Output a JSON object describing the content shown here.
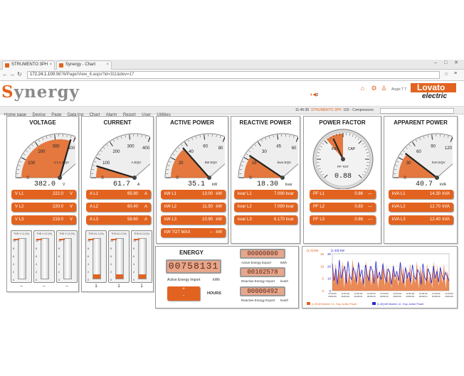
{
  "browser": {
    "tabs": [
      {
        "label": "STRUMENTO 3PH"
      },
      {
        "label": "Synergy - Chart"
      }
    ],
    "window_buttons": "– □ ✕",
    "url_host": "172.24.1.100",
    "url_path": ":9876/Page/View_6.aspx?id=311&dev=17"
  },
  "header": {
    "logo_s": "S",
    "logo_rest": "ynergy",
    "user": "Angie T T",
    "brand_top": "Lovato",
    "brand_bottom": "electric",
    "alarm_count": "2"
  },
  "menu": {
    "items": [
      "Home page",
      "Device",
      "Page",
      "Data log",
      "Chart",
      "Alarm",
      "Report",
      "User",
      "Utilities"
    ],
    "time": "11:46:38",
    "device": "STRUMENTO 3PH",
    "group": "102 - Compressors"
  },
  "voltage": {
    "title": "VOLTAGE",
    "gauge_value": "382.0",
    "gauge_unit": "V",
    "gauge_sub": "V L-L EQV",
    "ticks": [
      "0",
      "100",
      "200",
      "300",
      "400",
      "500"
    ],
    "rows": [
      {
        "label": "V L1",
        "value": "222.0",
        "unit": "V"
      },
      {
        "label": "V L2",
        "value": "220.0",
        "unit": "V"
      },
      {
        "label": "V L3",
        "value": "219.0",
        "unit": "V"
      }
    ],
    "bars": [
      {
        "title": "THD V L1 (%)",
        "ticks": [
          "10",
          "8",
          "6",
          "4",
          "2",
          "0"
        ],
        "value": "--",
        "level": 0
      },
      {
        "title": "THD V L2 (%)",
        "ticks": [
          "10",
          "8",
          "6",
          "4",
          "2",
          "0"
        ],
        "value": "--",
        "level": 0
      },
      {
        "title": "THD V L3 (%)",
        "ticks": [
          "10",
          "8",
          "6",
          "4",
          "2",
          "0"
        ],
        "value": "--",
        "level": 0
      }
    ]
  },
  "current": {
    "title": "CURRENT",
    "gauge_value": "61.7",
    "gauge_unit": "A",
    "gauge_sub": "A EQV",
    "ticks": [
      "0",
      "100",
      "200",
      "300",
      "400",
      "500"
    ],
    "rows": [
      {
        "label": "A L1",
        "value": "65.90",
        "unit": "A"
      },
      {
        "label": "A L2",
        "value": "60.40",
        "unit": "A"
      },
      {
        "label": "A L3",
        "value": "58.60",
        "unit": "A"
      }
    ],
    "bars": [
      {
        "title": "THD A L1 (%)",
        "ticks": [
          "10",
          "8",
          "6",
          "4",
          "2",
          "0"
        ],
        "value": "1",
        "level": 0.1
      },
      {
        "title": "THD A L2 (%)",
        "ticks": [
          "10",
          "8",
          "6",
          "4",
          "2",
          "0"
        ],
        "value": "1",
        "level": 0.1
      },
      {
        "title": "THD A L3 (%)",
        "ticks": [
          "10",
          "8",
          "6",
          "4",
          "2",
          "0"
        ],
        "value": "1",
        "level": 0.1
      }
    ]
  },
  "active": {
    "title": "ACTIVE POWER",
    "gauge_value": "35.1",
    "gauge_unit": "kW",
    "gauge_sub": "kW EQV",
    "ticks": [
      "0",
      "20",
      "40",
      "60",
      "80",
      "100"
    ],
    "rows": [
      {
        "label": "kW L1",
        "value": "13.00",
        "unit": "kW"
      },
      {
        "label": "kW L2",
        "value": "11.50",
        "unit": "kW"
      },
      {
        "label": "kW L3",
        "value": "10.90",
        "unit": "kW"
      },
      {
        "label": "kW TOT MAX",
        "value": "--",
        "unit": "kW"
      }
    ]
  },
  "reactive": {
    "title": "REACTIVE POWER",
    "gauge_value": "18.30",
    "gauge_unit": "kvar",
    "gauge_sub": "kvar EQV",
    "ticks": [
      "0",
      "15",
      "30",
      "45",
      "60",
      "75"
    ],
    "rows": [
      {
        "label": "kvar L1",
        "value": "7.090",
        "unit": "kvar"
      },
      {
        "label": "kvar L2",
        "value": "7.090",
        "unit": "kvar"
      },
      {
        "label": "kvar L3",
        "value": "6.170",
        "unit": "kvar"
      }
    ]
  },
  "pf": {
    "title": "POWER FACTOR",
    "gauge_value": "0.88",
    "gauge_sub": "PF TOT",
    "ind": "IND",
    "cap": "CAP",
    "rows": [
      {
        "label": "PF L1",
        "value": "0.86",
        "unit": "---"
      },
      {
        "label": "PF L2",
        "value": "0.83",
        "unit": "---"
      },
      {
        "label": "PF L3",
        "value": "0.86",
        "unit": "---"
      }
    ]
  },
  "apparent": {
    "title": "APPARENT POWER",
    "gauge_value": "40.7",
    "gauge_unit": "kVA",
    "gauge_sub": "kVA EQV",
    "ticks": [
      "0",
      "30",
      "60",
      "90",
      "120",
      "150"
    ],
    "rows": [
      {
        "label": "kVA L1",
        "value": "14.30",
        "unit": "kVA"
      },
      {
        "label": "kVA L2",
        "value": "12.70",
        "unit": "kVA"
      },
      {
        "label": "kVA L3",
        "value": "12.40",
        "unit": "kVA"
      }
    ]
  },
  "energy": {
    "title": "ENERGY",
    "main_lcd": "00758131",
    "main_label": "Active Energy Import",
    "main_unit": "kWh",
    "btn_plus": "+",
    "btn_minus": "-",
    "hours": "HOURS",
    "lcd_export": "00000000",
    "lbl_export": "Active Energy Export",
    "unit_export": "kWh",
    "lcd_rimport": "00102578",
    "lbl_rimport": "Reactive Energy Import",
    "unit_rimport": "kvarh",
    "lcd_rexport": "00000492",
    "lbl_rexport": "Reactive Energy Export",
    "unit_rexport": "kvarh"
  },
  "chart_data": {
    "type": "line",
    "left_axis_label": "[1.0] kW",
    "right_axis_label": "[1.40] kW",
    "left_ticks": [
      "15",
      "10",
      "5",
      "0"
    ],
    "right_ticks": [
      "30",
      "20",
      "10",
      "0"
    ],
    "x_labels": [
      "12:50:00",
      "12:50:00",
      "12:50:00",
      "12:50:00",
      "12:50:00",
      "12:50:00",
      "12:50:00",
      "12:50:00",
      "12:50:00",
      "12:50:00"
    ],
    "x_labels_2": [
      "20/02/19",
      "20/02/19",
      "20/02/19",
      "20/02/19",
      "20/02/19",
      "20/02/19",
      "20/02/19",
      "20/02/19",
      "20/02/19",
      "20/02/19"
    ],
    "ylim_left": [
      0,
      15
    ],
    "ylim_right": [
      0,
      30
    ],
    "series": [
      {
        "name": "[1.0] kW Modem 14 - Equ. Active Power",
        "color": "#e2631f",
        "kind": "area",
        "values": [
          12,
          3,
          11,
          2,
          9,
          4,
          12,
          1,
          10,
          3,
          8,
          2,
          13,
          4,
          9,
          2,
          11,
          3,
          7,
          1,
          12,
          4,
          10,
          2,
          9,
          3,
          11,
          1,
          8,
          4,
          12,
          2,
          10,
          3,
          9,
          1,
          11,
          4,
          7,
          2,
          12,
          3,
          10,
          1,
          9,
          4,
          11,
          2,
          8,
          3,
          12,
          1,
          10,
          4,
          9,
          2,
          11,
          3,
          8,
          1,
          12,
          4,
          10,
          2,
          9,
          3,
          11,
          1,
          8,
          4
        ]
      },
      {
        "name": "[1.40] kW Modem 14 - Equ. Active Power",
        "color": "#2a2ad0",
        "kind": "line",
        "values": [
          22,
          8,
          18,
          5,
          25,
          10,
          15,
          20,
          6,
          24,
          12,
          9,
          19,
          14,
          7,
          23,
          11,
          17,
          5,
          21,
          13,
          8,
          20,
          16,
          6,
          24,
          10,
          15,
          9,
          22,
          12,
          7,
          18,
          14,
          5,
          20,
          11,
          16,
          8,
          23,
          13,
          6,
          19,
          10,
          15,
          7,
          21,
          12,
          9,
          17,
          14,
          5,
          22,
          11,
          8,
          18,
          13,
          6,
          20,
          10,
          16,
          7,
          19,
          12,
          9,
          15,
          11,
          8
        ]
      }
    ]
  }
}
